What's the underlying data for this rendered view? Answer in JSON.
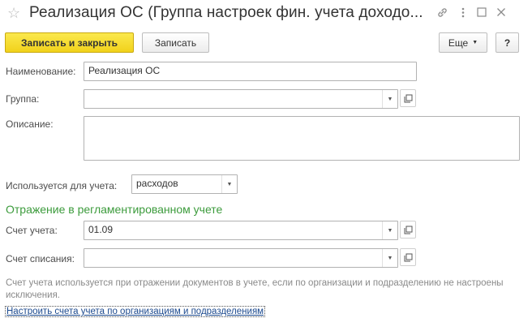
{
  "window": {
    "title": "Реализация ОС (Группа настроек фин. учета доходо...",
    "icons": [
      "star-icon",
      "link-icon",
      "menu-dots-icon",
      "maximize-icon",
      "close-icon"
    ]
  },
  "toolbar": {
    "save_close_label": "Записать и закрыть",
    "save_label": "Записать",
    "more_label": "Еще",
    "help_label": "?"
  },
  "form": {
    "name_label": "Наименование:",
    "name_value": "Реализация ОС",
    "group_label": "Группа:",
    "group_value": "",
    "description_label": "Описание:",
    "description_value": "",
    "used_for_label": "Используется для учета:",
    "used_for_value": "расходов"
  },
  "section": {
    "title": "Отражение в регламентированном учете",
    "account_label": "Счет учета:",
    "account_value": "01.09",
    "writeoff_label": "Счет списания:",
    "writeoff_value": ""
  },
  "hint": {
    "text": "Счет учета используется при отражении документов в учете, если по организации и подразделению не настроены исключения.",
    "link": "Настроить счета учета по организациям и подразделениям"
  },
  "colors": {
    "primary_button": "#f3d62a",
    "section_title": "#3c9b3c",
    "link": "#1c4a8f"
  }
}
